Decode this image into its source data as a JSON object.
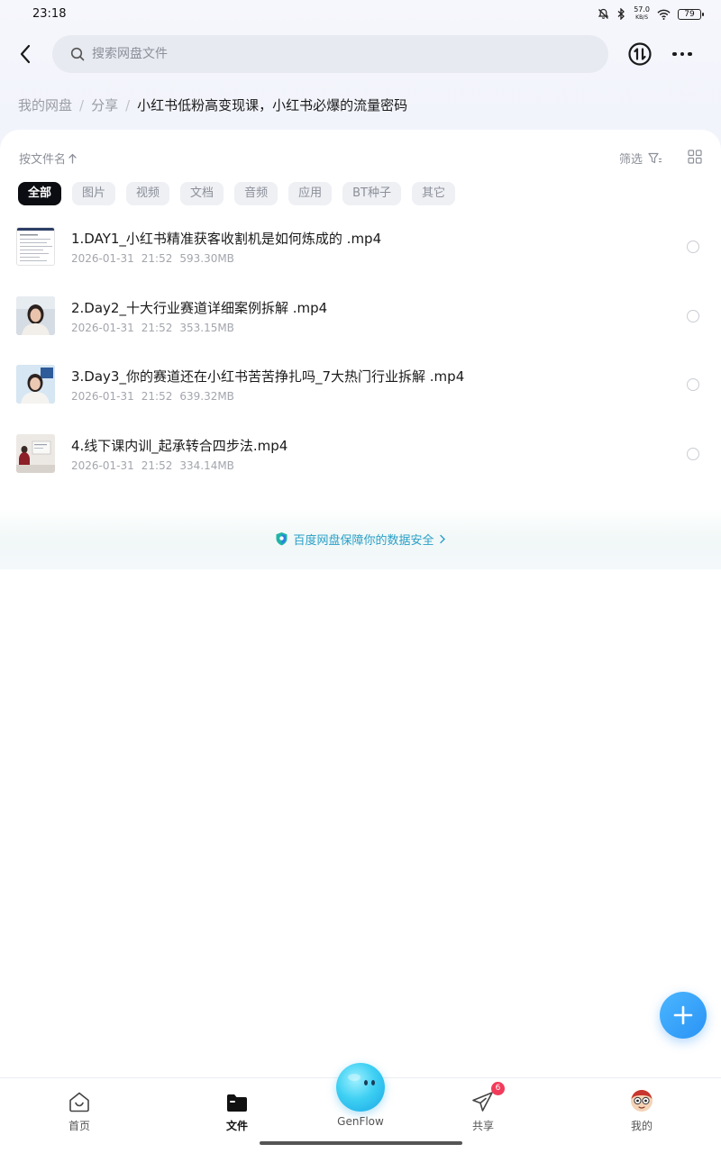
{
  "status_bar": {
    "time": "23:18",
    "net_speed_value": "57.0",
    "net_speed_unit": "KB/S",
    "battery": "79"
  },
  "header": {
    "search_placeholder": "搜索网盘文件"
  },
  "breadcrumb": {
    "root": "我的网盘",
    "sep1": "/",
    "middle": "分享",
    "sep2": "/",
    "current": "小红书低粉高变现课，小红书必爆的流量密码"
  },
  "toolbar": {
    "sort_label": "按文件名",
    "filter_label": "筛选"
  },
  "chips": [
    "全部",
    "图片",
    "视频",
    "文档",
    "音频",
    "应用",
    "BT种子",
    "其它"
  ],
  "files": [
    {
      "name": "1.DAY1_小红书精准获客收割机是如何炼成的 .mp4",
      "date": "2026-01-31",
      "time": "21:52",
      "size": "593.30MB",
      "thumb": "slides-thumb"
    },
    {
      "name": "2.Day2_十大行业赛道详细案例拆解 .mp4",
      "date": "2026-01-31",
      "time": "21:52",
      "size": "353.15MB",
      "thumb": "presenter-thumb"
    },
    {
      "name": "3.Day3_你的赛道还在小红书苦苦挣扎吗_7大热门行业拆解 .mp4",
      "date": "2026-01-31",
      "time": "21:52",
      "size": "639.32MB",
      "thumb": "presenter-thumb"
    },
    {
      "name": "4.线下课内训_起承转合四步法.mp4",
      "date": "2026-01-31",
      "time": "21:52",
      "size": "334.14MB",
      "thumb": "classroom-thumb"
    }
  ],
  "security_banner": {
    "text": "百度网盘保障你的数据安全"
  },
  "tabs": {
    "home": "首页",
    "files": "文件",
    "genflow": "GenFlow",
    "share": "共享",
    "share_badge": "6",
    "mine": "我的"
  },
  "colors": {
    "accent": "#2a93f5",
    "chip_active_bg": "#0c0d12",
    "security_text": "#2a9fc7",
    "badge": "#f23b5a"
  }
}
